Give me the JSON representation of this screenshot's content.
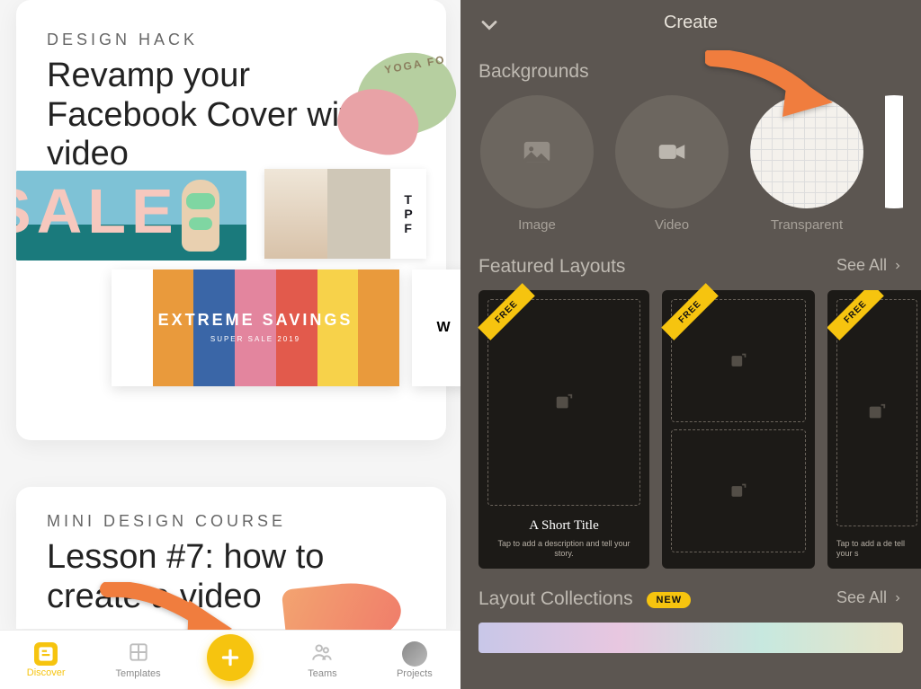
{
  "left": {
    "card1": {
      "eyebrow": "DESIGN HACK",
      "headline": "Revamp your Facebook Cover with video",
      "yoga_text": "YOGA  FO",
      "sale_word": "SALE",
      "tile_b_text": "P\nF",
      "extreme_title": "EXTREME SAVINGS",
      "extreme_sub": "SUPER SALE 2019",
      "tile_w_text": "W"
    },
    "card2": {
      "eyebrow": "MINI DESIGN COURSE",
      "headline": "Lesson #7: how to create a video"
    },
    "tabs": {
      "discover": "Discover",
      "templates": "Templates",
      "teams": "Teams",
      "projects": "Projects"
    }
  },
  "right": {
    "title": "Create",
    "backgrounds": {
      "label": "Backgrounds",
      "image": "Image",
      "video": "Video",
      "transparent": "Transparent"
    },
    "featured": {
      "label": "Featured Layouts",
      "see_all": "See All",
      "free": "FREE",
      "card1_title": "A Short Title",
      "card1_sub": "Tap to add a description and tell your story.",
      "card3_sub": "Tap to add a de\ntell your s"
    },
    "collections": {
      "label": "Layout Collections",
      "new": "NEW",
      "see_all": "See All"
    }
  }
}
